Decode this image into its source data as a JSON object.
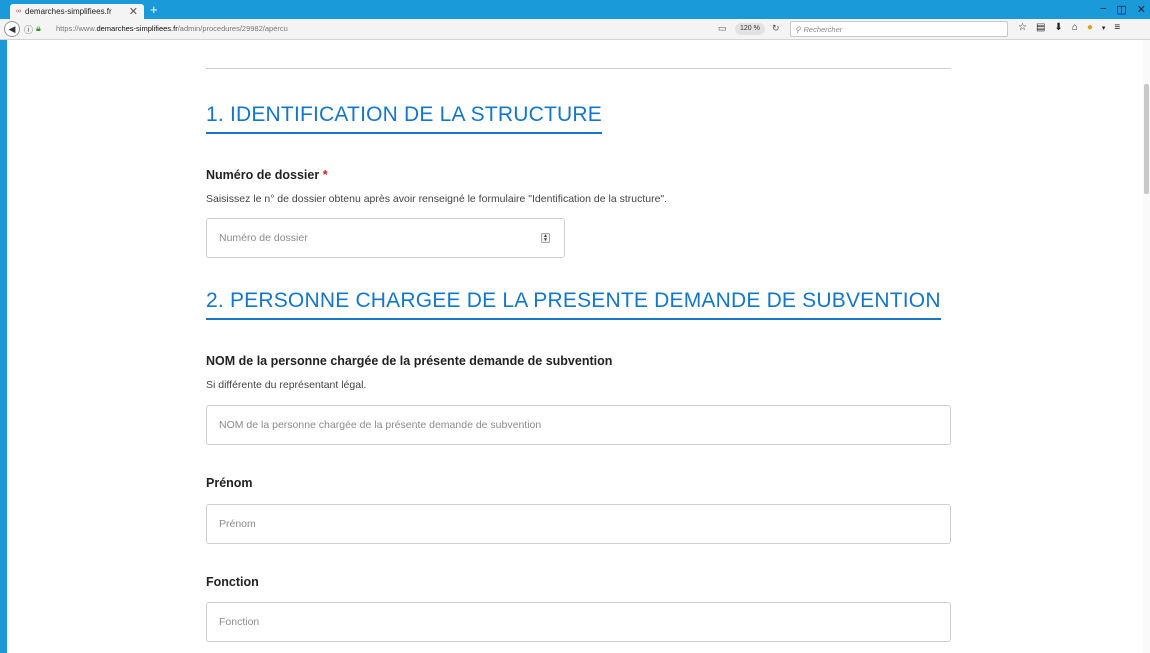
{
  "browser": {
    "tab_title": "demarches-simplifiees.fr",
    "tab_favicon": "∞",
    "tab_close": "✕",
    "new_tab": "+",
    "window_controls": [
      "−",
      "◫",
      "✕"
    ],
    "url_prefix": "https://www.",
    "url_domain": "demarches-simplifiees.fr",
    "url_path": "/admin/procedures/29982/apercu",
    "zoom": "120 %",
    "search_placeholder": "Rechercher"
  },
  "sections": [
    {
      "title": "1. IDENTIFICATION DE LA STRUCTURE"
    },
    {
      "title": "2. PERSONNE CHARGEE DE LA PRESENTE DEMANDE DE SUBVENTION"
    }
  ],
  "fields": {
    "dossier": {
      "label": "Numéro de dossier",
      "required_mark": "*",
      "description": "Saisissez le n° de dossier obtenu après avoir renseigné le formulaire \"Identification de la structure\".",
      "placeholder": "Numéro de dossier"
    },
    "nom": {
      "label": "NOM de la personne chargée de la présente demande de subvention",
      "description": "Si différente du représentant légal.",
      "placeholder": "NOM de la personne chargée de la présente demande de subvention"
    },
    "prenom": {
      "label": "Prénom",
      "placeholder": "Prénom"
    },
    "fonction": {
      "label": "Fonction",
      "placeholder": "Fonction"
    }
  }
}
